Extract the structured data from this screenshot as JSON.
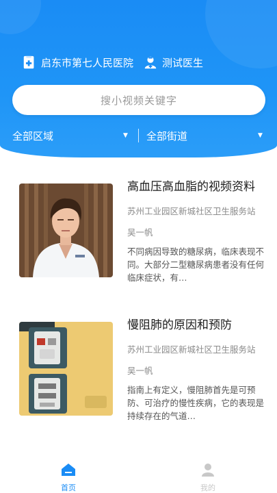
{
  "header": {
    "hospital": "启东市第七人民医院",
    "doctor": "测试医生",
    "hospital_icon": "hospital-icon",
    "doctor_icon": "doctor-icon"
  },
  "search": {
    "placeholder": "搜小视频关键字"
  },
  "filters": {
    "region": "全部区域",
    "street": "全部街道"
  },
  "videos": [
    {
      "title": "高血压高血脂的视频资料",
      "org": "苏州工业园区新城社区卫生服务站",
      "author": "吴一帆",
      "desc": "不同病因导致的糖尿病，临床表现不同。大部分二型糖尿病患者没有任何临床症状，有…"
    },
    {
      "title": "慢阻肺的原因和预防",
      "org": "苏州工业园区新城社区卫生服务站",
      "author": "吴一帆",
      "desc": "指南上有定义，慢阻肺首先是可预防、可治疗的慢性疾病，它的表现是持续存在的气道…"
    }
  ],
  "tabbar": {
    "home": "首页",
    "mine": "我的"
  },
  "colors": {
    "primary": "#1a8cf5",
    "tab_active": "#1a8cf5",
    "tab_inactive": "#c8c8c8"
  }
}
